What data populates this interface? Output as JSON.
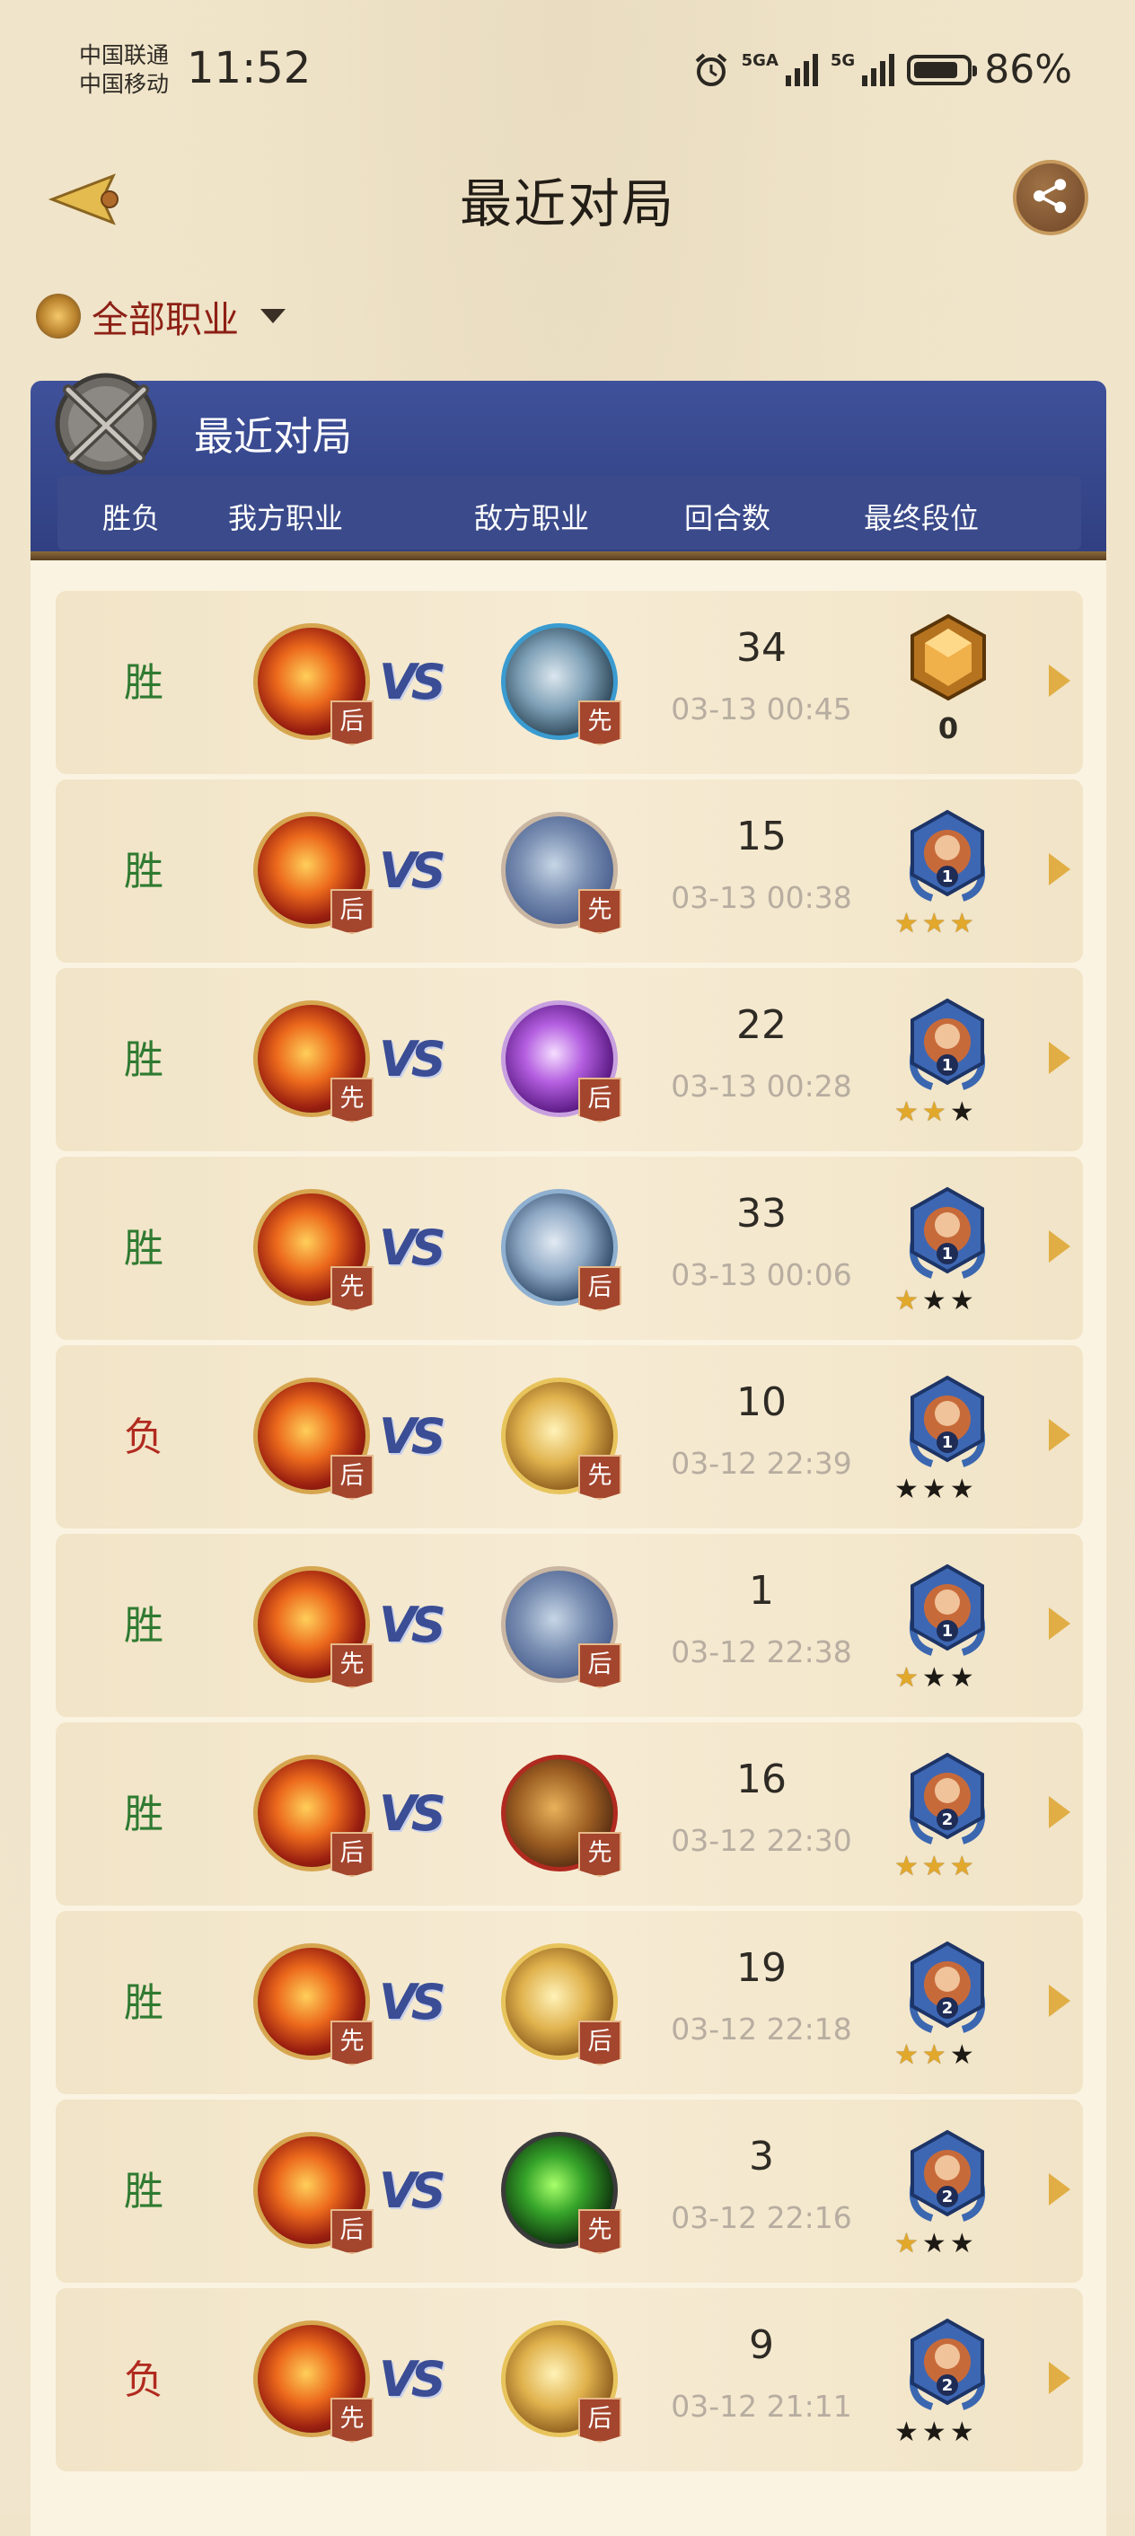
{
  "status_bar": {
    "carrier_1": "中国联通",
    "carrier_2": "中国移动",
    "time": "11:52",
    "network_1": "5GA",
    "network_2": "5G",
    "battery_percent": "86%",
    "battery_level": 0.86
  },
  "header": {
    "title": "最近对局",
    "back_icon": "back-arrow-icon",
    "share_icon": "share-icon"
  },
  "filter": {
    "label": "全部职业",
    "icon": "class-emblem-icon"
  },
  "panel": {
    "title": "最近对局",
    "columns": [
      "胜负",
      "我方职业",
      "敌方职业",
      "回合数",
      "最终段位"
    ]
  },
  "matches": [
    {
      "result": "胜",
      "result_type": "win",
      "my_order": "后",
      "enemy_class": "steel",
      "enemy_order": "先",
      "turns": "34",
      "date": "03-13 00:45",
      "rank_type": "gem",
      "rank_value": "0",
      "stars": []
    },
    {
      "result": "胜",
      "result_type": "win",
      "my_order": "后",
      "enemy_class": "claw",
      "enemy_order": "先",
      "turns": "15",
      "date": "03-13 00:38",
      "rank_type": "medal",
      "rank_value": "1",
      "stars": [
        "gold",
        "gold",
        "gold"
      ]
    },
    {
      "result": "胜",
      "result_type": "win",
      "my_order": "先",
      "enemy_class": "purple",
      "enemy_order": "后",
      "turns": "22",
      "date": "03-13 00:28",
      "rank_type": "medal",
      "rank_value": "1",
      "stars": [
        "gold",
        "gold",
        "dark"
      ]
    },
    {
      "result": "胜",
      "result_type": "win",
      "my_order": "先",
      "enemy_class": "sword",
      "enemy_order": "后",
      "turns": "33",
      "date": "03-13 00:06",
      "rank_type": "medal",
      "rank_value": "1",
      "stars": [
        "gold",
        "dark",
        "dark"
      ]
    },
    {
      "result": "负",
      "result_type": "loss",
      "my_order": "后",
      "enemy_class": "hammer",
      "enemy_order": "先",
      "turns": "10",
      "date": "03-12 22:39",
      "rank_type": "medal",
      "rank_value": "1",
      "stars": [
        "dark",
        "dark",
        "dark"
      ]
    },
    {
      "result": "胜",
      "result_type": "win",
      "my_order": "先",
      "enemy_class": "claw",
      "enemy_order": "后",
      "turns": "1",
      "date": "03-12 22:38",
      "rank_type": "medal",
      "rank_value": "1",
      "stars": [
        "gold",
        "dark",
        "dark"
      ]
    },
    {
      "result": "胜",
      "result_type": "win",
      "my_order": "后",
      "enemy_class": "shield",
      "enemy_order": "先",
      "turns": "16",
      "date": "03-12 22:30",
      "rank_type": "medal",
      "rank_value": "2",
      "stars": [
        "gold",
        "gold",
        "gold"
      ]
    },
    {
      "result": "胜",
      "result_type": "win",
      "my_order": "先",
      "enemy_class": "hammer",
      "enemy_order": "后",
      "turns": "19",
      "date": "03-12 22:18",
      "rank_type": "medal",
      "rank_value": "2",
      "stars": [
        "gold",
        "gold",
        "dark"
      ]
    },
    {
      "result": "胜",
      "result_type": "win",
      "my_order": "后",
      "enemy_class": "green",
      "enemy_order": "先",
      "turns": "3",
      "date": "03-12 22:16",
      "rank_type": "medal",
      "rank_value": "2",
      "stars": [
        "gold",
        "dark",
        "dark"
      ]
    },
    {
      "result": "负",
      "result_type": "loss",
      "my_order": "先",
      "enemy_class": "hammer",
      "enemy_order": "后",
      "turns": "9",
      "date": "03-12 21:11",
      "rank_type": "medal",
      "rank_value": "2",
      "stars": [
        "dark",
        "dark",
        "dark"
      ]
    }
  ],
  "vs_label": "VS",
  "colors": {
    "win": "#2f7a31",
    "loss": "#b12a1f",
    "panel_header": "#3f519a",
    "accent_red": "#8d1f14"
  }
}
